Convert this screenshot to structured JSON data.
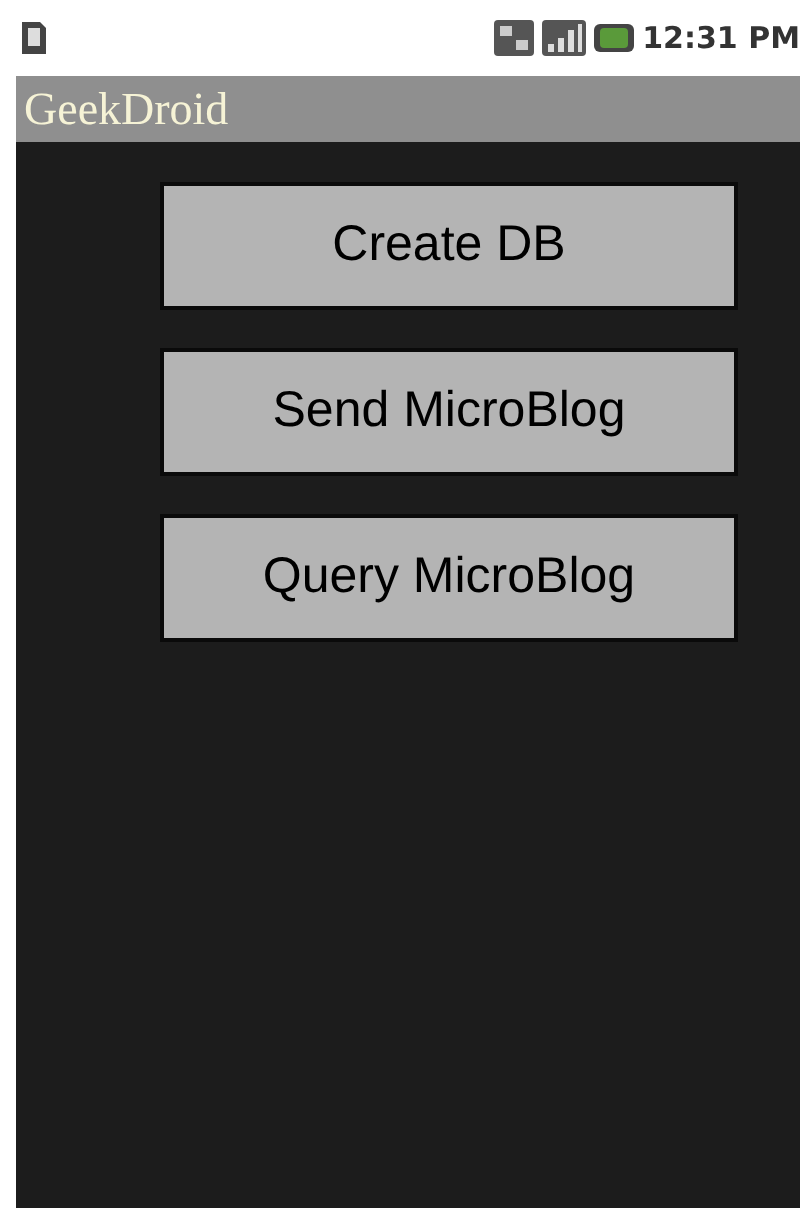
{
  "status_bar": {
    "time": "12:31 PM"
  },
  "title_bar": {
    "title": "GeekDroid"
  },
  "buttons": [
    {
      "label": "Create DB"
    },
    {
      "label": "Send MicroBlog"
    },
    {
      "label": "Query MicroBlog"
    }
  ]
}
